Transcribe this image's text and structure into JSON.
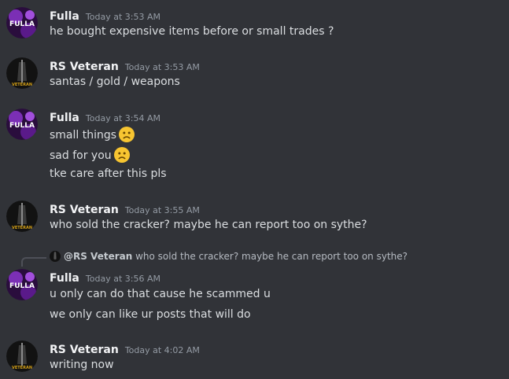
{
  "messages": [
    {
      "author": "Fulla",
      "timestamp": "Today at 3:53 AM",
      "avatar": "fulla-avatar",
      "lines": [
        "he bought expensive items before or small trades ?"
      ]
    },
    {
      "author": "RS Veteran",
      "timestamp": "Today at 3:53 AM",
      "avatar": "veteran-avatar",
      "lines": [
        "santas / gold / weapons"
      ]
    },
    {
      "author": "Fulla",
      "timestamp": "Today at 3:54 AM",
      "avatar": "fulla-avatar",
      "lines": [
        "small things",
        "sad for you",
        "tke care after this pls"
      ]
    },
    {
      "author": "RS Veteran",
      "timestamp": "Today at 3:55 AM",
      "avatar": "veteran-avatar",
      "lines": [
        "who sold the cracker? maybe he can report too on sythe?"
      ]
    },
    {
      "reply": {
        "author": "@RS Veteran",
        "text": "who sold the cracker? maybe he can report too on sythe?"
      },
      "author": "Fulla",
      "timestamp": "Today at 3:56 AM",
      "avatar": "fulla-avatar",
      "lines": [
        "u only can do that cause he scammed u",
        "we only can like ur posts that will do"
      ]
    },
    {
      "author": "RS Veteran",
      "timestamp": "Today at 4:02 AM",
      "avatar": "veteran-avatar",
      "lines": [
        "writing now"
      ]
    }
  ],
  "avatars": {
    "fulla_text": "FULLA",
    "veteran_text": "VETERAN"
  },
  "emoji": "frowning-face",
  "colors": {
    "background": "#313338",
    "author": "#f2f3f5",
    "timestamp": "#949ba4",
    "text": "#dbdee1",
    "emoji": "#f7c531"
  }
}
